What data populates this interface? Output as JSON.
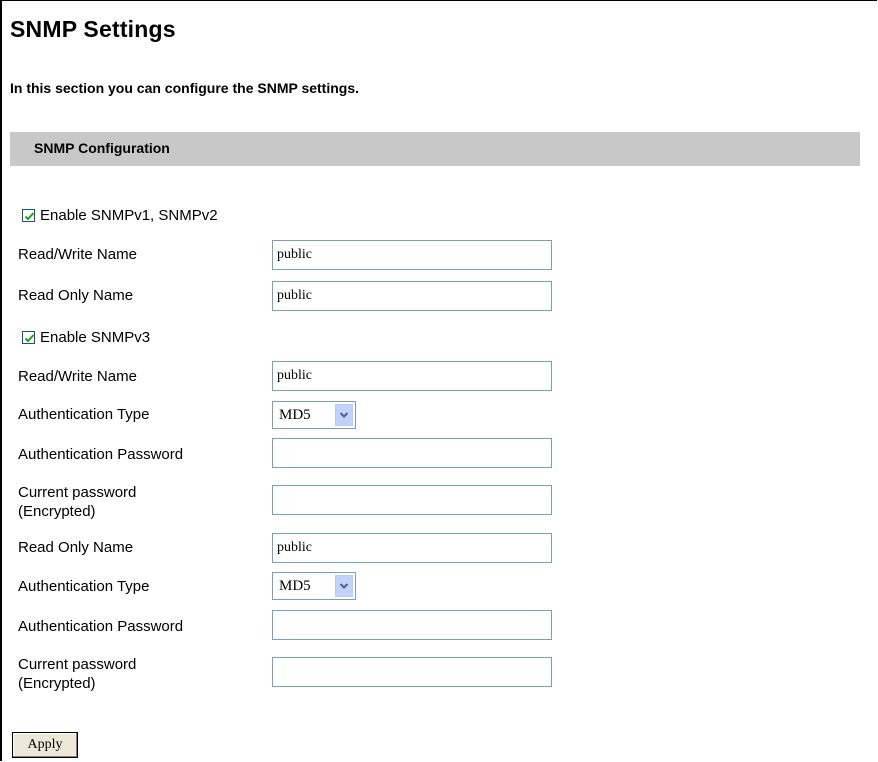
{
  "page": {
    "title": "SNMP Settings",
    "description": "In this section you can configure the SNMP settings."
  },
  "section": {
    "title": "SNMP Configuration"
  },
  "snmpv12": {
    "enable_label": "Enable SNMPv1, SNMPv2",
    "enabled": true,
    "rw_name_label": "Read/Write Name",
    "rw_name_value": "public",
    "ro_name_label": "Read Only Name",
    "ro_name_value": "public"
  },
  "snmpv3": {
    "enable_label": "Enable SNMPv3",
    "enabled": true,
    "rw": {
      "name_label": "Read/Write Name",
      "name_value": "public",
      "auth_type_label": "Authentication Type",
      "auth_type_value": "MD5",
      "auth_password_label": "Authentication Password",
      "auth_password_value": "",
      "current_password_label_line1": "Current password",
      "current_password_label_line2": "(Encrypted)",
      "current_password_value": ""
    },
    "ro": {
      "name_label": "Read Only Name",
      "name_value": "public",
      "auth_type_label": "Authentication Type",
      "auth_type_value": "MD5",
      "auth_password_label": "Authentication Password",
      "auth_password_value": "",
      "current_password_label_line1": "Current password",
      "current_password_label_line2": "(Encrypted)",
      "current_password_value": ""
    }
  },
  "actions": {
    "apply_label": "Apply"
  },
  "icons": {
    "checkbox": "checkmark-icon",
    "dropdown": "chevron-down-icon"
  },
  "colors": {
    "section_bar": "#c8c8c8",
    "checkmark": "#21a121",
    "dropdown_button": "#c1d3fb"
  }
}
